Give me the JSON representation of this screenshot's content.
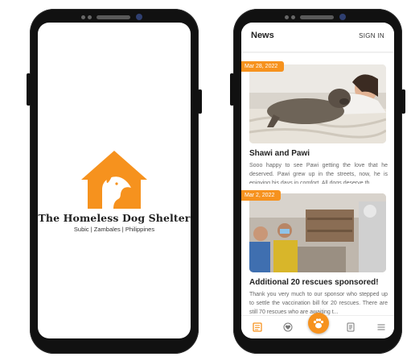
{
  "splash": {
    "brand_title": "The Homeless Dog Shelter",
    "brand_subtitle": "Subic | Zambales | Philippines",
    "brand_color": "#f6921e"
  },
  "news_app": {
    "header": {
      "title": "News",
      "signin_label": "SIGN IN"
    },
    "posts": [
      {
        "date": "Mar 28, 2022",
        "title": "Shawi and Pawi",
        "excerpt": "Sooo happy to see Pawi getting the love that he deserved. Pawi grew up in the streets, now, he is enjoying his days in comfort. All dogs deserve th..."
      },
      {
        "date": "Mar 2, 2022",
        "title": "Additional 20 rescues sponsored!",
        "excerpt": "Thank you very much to our sponsor who stepped up to settle the vaccination bill for 20 rescues. There are still 70 rescues who are awaiting t..."
      }
    ],
    "bottom_nav": [
      "news-icon",
      "heart-icon",
      "paw-icon",
      "document-icon",
      "menu-icon"
    ]
  }
}
